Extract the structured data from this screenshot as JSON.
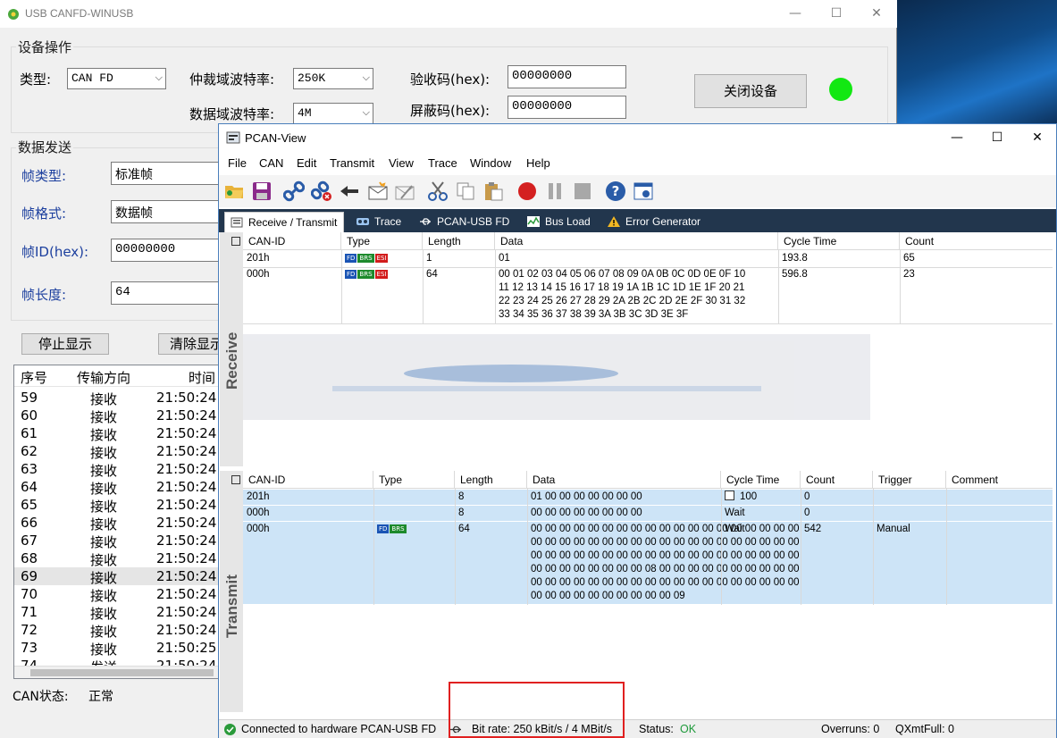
{
  "back_window": {
    "title": "USB CANFD-WINUSB",
    "controls": {
      "minimize": "—",
      "maximize": "☐",
      "close": "✕"
    },
    "device_group": {
      "title": "设备操作",
      "type_label": "类型:",
      "type_value": "CAN FD",
      "arb_rate_label": "仲裁域波特率:",
      "arb_rate_value": "250K",
      "data_rate_label": "数据域波特率:",
      "data_rate_value": "4M",
      "accept_code_label": "验收码(hex):",
      "accept_code_value": "00000000",
      "mask_code_label": "屏蔽码(hex):",
      "mask_code_value": "00000000",
      "close_button": "关闭设备",
      "status_led_color": "#12e812"
    },
    "send_group": {
      "title": "数据发送",
      "frame_type_label": "帧类型:",
      "frame_type_value": "标准帧",
      "frame_format_label": "帧格式:",
      "frame_format_value": "数据帧",
      "frame_id_label": "帧ID(hex):",
      "frame_id_value": "00000000",
      "frame_len_label": "帧长度:",
      "frame_len_value": "64"
    },
    "stop_display_button": "停止显示",
    "clear_display_button": "清除显示",
    "list": {
      "headers": [
        "序号",
        "传输方向",
        "时间"
      ],
      "rows": [
        {
          "no": "59",
          "dir": "接收",
          "time": "21:50:24"
        },
        {
          "no": "60",
          "dir": "接收",
          "time": "21:50:24"
        },
        {
          "no": "61",
          "dir": "接收",
          "time": "21:50:24"
        },
        {
          "no": "62",
          "dir": "接收",
          "time": "21:50:24"
        },
        {
          "no": "63",
          "dir": "接收",
          "time": "21:50:24"
        },
        {
          "no": "64",
          "dir": "接收",
          "time": "21:50:24"
        },
        {
          "no": "65",
          "dir": "接收",
          "time": "21:50:24"
        },
        {
          "no": "66",
          "dir": "接收",
          "time": "21:50:24"
        },
        {
          "no": "67",
          "dir": "接收",
          "time": "21:50:24"
        },
        {
          "no": "68",
          "dir": "接收",
          "time": "21:50:24"
        },
        {
          "no": "69",
          "dir": "接收",
          "time": "21:50:24"
        },
        {
          "no": "70",
          "dir": "接收",
          "time": "21:50:24"
        },
        {
          "no": "71",
          "dir": "接收",
          "time": "21:50:24"
        },
        {
          "no": "72",
          "dir": "接收",
          "time": "21:50:24"
        },
        {
          "no": "73",
          "dir": "接收",
          "time": "21:50:25"
        },
        {
          "no": "74",
          "dir": "发送",
          "time": "21:50:24"
        }
      ],
      "selected_row": "69"
    },
    "can_status_label": "CAN状态:",
    "can_status_value": "正常"
  },
  "pcan": {
    "title": "PCAN-View",
    "controls": {
      "minimize": "—",
      "maximize": "☐",
      "close": "✕"
    },
    "menu": [
      "File",
      "CAN",
      "Edit",
      "Transmit",
      "View",
      "Trace",
      "Window",
      "Help"
    ],
    "toolbar_icons": [
      "open-folder-icon",
      "save-icon",
      "connect-icon",
      "disconnect-icon",
      "reset-icon",
      "new-message-icon",
      "edit-message-icon",
      "cut-icon",
      "copy-icon",
      "paste-icon",
      "record-icon",
      "pause-icon",
      "stop-icon",
      "help-icon",
      "about-icon"
    ],
    "tabs": [
      {
        "label": "Receive / Transmit",
        "icon": "receive-transmit-icon"
      },
      {
        "label": "Trace",
        "icon": "trace-icon"
      },
      {
        "label": "PCAN-USB FD",
        "icon": "usb-icon"
      },
      {
        "label": "Bus Load",
        "icon": "bus-load-icon"
      },
      {
        "label": "Error Generator",
        "icon": "warning-icon"
      }
    ],
    "receive": {
      "side_label": "Receive",
      "headers": [
        "CAN-ID",
        "Type",
        "Length",
        "Data",
        "Cycle Time",
        "Count"
      ],
      "rows": [
        {
          "id": "201h",
          "flags": [
            "FD",
            "BRS",
            "ESI"
          ],
          "length": "1",
          "data": [
            "01"
          ],
          "cycle": "193.8",
          "count": "65"
        },
        {
          "id": "000h",
          "flags": [
            "FD",
            "BRS",
            "ESI"
          ],
          "length": "64",
          "data": [
            "00 01 02 03 04 05 06 07 08 09 0A 0B 0C 0D 0E 0F 10",
            "11 12 13 14 15 16 17 18 19 1A 1B 1C 1D 1E 1F 20 21",
            "22 23 24 25 26 27 28 29 2A 2B 2C 2D 2E 2F 30 31 32",
            "33 34 35 36 37 38 39 3A 3B 3C 3D 3E 3F"
          ],
          "cycle": "596.8",
          "count": "23"
        }
      ]
    },
    "transmit": {
      "side_label": "Transmit",
      "headers": [
        "CAN-ID",
        "Type",
        "Length",
        "Data",
        "Cycle Time",
        "Count",
        "Trigger",
        "Comment"
      ],
      "rows": [
        {
          "id": "201h",
          "flags": [],
          "length": "8",
          "data": [
            "01 00 00 00 00 00 00 00"
          ],
          "cycle": "100",
          "cycle_checkbox": true,
          "count": "0",
          "trigger": "",
          "comment": ""
        },
        {
          "id": "000h",
          "flags": [],
          "length": "8",
          "data": [
            "00 00 00 00 00 00 00 00"
          ],
          "cycle": "Wait",
          "cycle_checkbox": false,
          "count": "0",
          "trigger": "",
          "comment": ""
        },
        {
          "id": "000h",
          "flags": [
            "FD",
            "BRS"
          ],
          "length": "64",
          "data": [
            "00 00 00 00 00 00 00 00 00 00 00 00 00 00 00 00 00 00 00",
            "00 00 00 00 00 00 00 00 00 00 00 00 00 00 00 00 00 00 00",
            "00 00 00 00 00 00 00 00 00 00 00 00 00 00 00 00 00 00 00",
            "00 00 00 00 00 00 00 00 08 00 00 00 00 00 00 00 00 00 00",
            "00 00 00 00 00 00 00 00 00 00 00 00 00 00 00 00 00 00 00",
            "00 00 00 00 00 00 00 00 00 00 09"
          ],
          "cycle": "Wait",
          "cycle_checkbox": false,
          "count": "542",
          "trigger": "Manual",
          "comment": ""
        }
      ]
    },
    "status_bar": {
      "connection": "Connected to hardware PCAN-USB FD",
      "bitrate": "Bit rate: 250 kBit/s / 4 MBit/s",
      "status_label": "Status:",
      "status_value": "OK",
      "overruns": "Overruns: 0",
      "qxmtfull": "QXmtFull: 0"
    }
  }
}
